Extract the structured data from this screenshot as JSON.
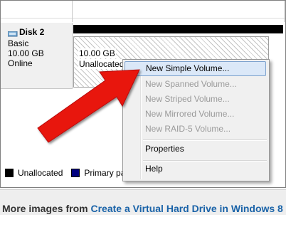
{
  "disk": {
    "name": "Disk 2",
    "type": "Basic",
    "size": "10.00 GB",
    "status": "Online"
  },
  "partition": {
    "size": "10.00 GB",
    "state": "Unallocated"
  },
  "legend": [
    {
      "label": "Unallocated",
      "color": "#000000"
    },
    {
      "label": "Primary partit",
      "color": "#000080"
    }
  ],
  "context_menu": {
    "items": [
      {
        "label": "New Simple Volume...",
        "enabled": true,
        "highlighted": true
      },
      {
        "label": "New Spanned Volume...",
        "enabled": false
      },
      {
        "label": "New Striped Volume...",
        "enabled": false
      },
      {
        "label": "New Mirrored Volume...",
        "enabled": false
      },
      {
        "label": "New RAID-5 Volume...",
        "enabled": false
      },
      {
        "label": "Properties",
        "enabled": true
      },
      {
        "label": "Help",
        "enabled": true
      }
    ]
  },
  "caption": {
    "prefix": "More images from ",
    "link": "Create a Virtual Hard Drive in Windows 8"
  },
  "colors": {
    "arrow": "#e8130f",
    "highlight": "#dbe8f8",
    "link": "#1a63a8"
  }
}
